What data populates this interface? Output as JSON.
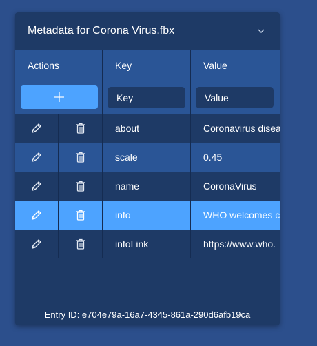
{
  "panel": {
    "title": "Metadata for Corona Virus.fbx",
    "collapse_icon": "chevron-down-icon"
  },
  "table": {
    "headers": {
      "actions": "Actions",
      "key": "Key",
      "value": "Value"
    },
    "new_entry": {
      "add_icon": "plus-icon",
      "key_placeholder": "Key",
      "value_placeholder": "Value"
    },
    "rows": [
      {
        "key": "about",
        "value": "Coronavirus disea",
        "edit_icon": "pencil-icon",
        "delete_icon": "trash-icon"
      },
      {
        "key": "scale",
        "value": "0.45",
        "edit_icon": "pencil-icon",
        "delete_icon": "trash-icon"
      },
      {
        "key": "name",
        "value": "CoronaVirus",
        "edit_icon": "pencil-icon",
        "delete_icon": "trash-icon"
      },
      {
        "key": "info",
        "value": "WHO welcomes c",
        "edit_icon": "pencil-icon",
        "delete_icon": "trash-icon",
        "selected": true
      },
      {
        "key": "infoLink",
        "value": "https://www.who.",
        "edit_icon": "pencil-icon",
        "delete_icon": "trash-icon"
      }
    ]
  },
  "footer": {
    "entry_id": "Entry ID: e704e79a-16a7-4345-861a-290d6afb19ca"
  },
  "colors": {
    "background": "#2c4f8c",
    "panel": "#1e3a66",
    "row_light": "#2a5596",
    "accent": "#4da3ff",
    "text": "#ffffff"
  }
}
